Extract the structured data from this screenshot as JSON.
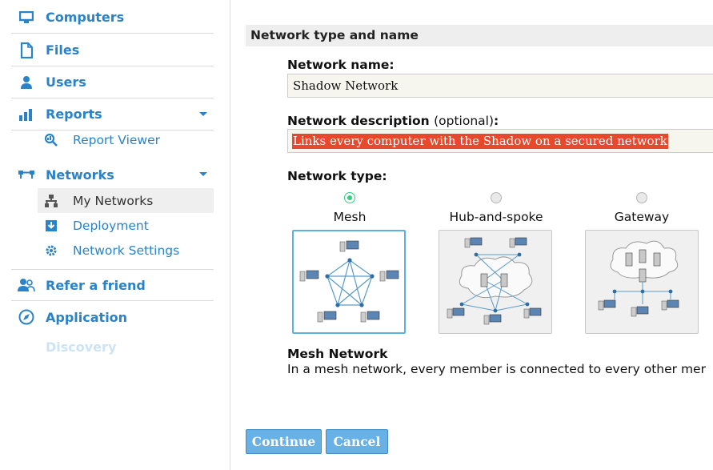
{
  "sidebar": {
    "items": [
      {
        "label": "Computers",
        "icon": "monitor-icon"
      },
      {
        "label": "Files",
        "icon": "file-icon"
      },
      {
        "label": "Users",
        "icon": "user-icon"
      },
      {
        "label": "Reports",
        "icon": "bar-chart-icon",
        "expanded": true
      },
      {
        "label": "Report Viewer",
        "icon": "report-viewer-icon"
      },
      {
        "label": "Networks",
        "icon": "network-icon",
        "expanded": true
      },
      {
        "label": "My Networks",
        "icon": "hierarchy-icon",
        "active": true
      },
      {
        "label": "Deployment",
        "icon": "download-icon"
      },
      {
        "label": "Network Settings",
        "icon": "gear-icon"
      },
      {
        "label": "Refer a friend",
        "icon": "refer-users-icon"
      },
      {
        "label": "Application",
        "icon": "compass-icon"
      },
      {
        "label": "Discovery",
        "icon": ""
      }
    ]
  },
  "main": {
    "section_title": "Network type and name",
    "name_label": "Network name:",
    "name_value": "Shadow Network",
    "description_label": "Network description",
    "description_optional": "(optional)",
    "description_colon": ":",
    "description_value": "Links every computer with the Shadow on a secured network",
    "type_label": "Network type:",
    "types": [
      {
        "label": "Mesh",
        "selected": true
      },
      {
        "label": "Hub-and-spoke",
        "selected": false
      },
      {
        "label": "Gateway",
        "selected": false
      }
    ],
    "selected_title": "Mesh Network",
    "selected_description": "In a mesh network, every member is connected to every other mer"
  },
  "buttons": {
    "continue": "Continue",
    "cancel": "Cancel"
  },
  "colors": {
    "accent": "#2a82c8",
    "button": "#68b1e6",
    "selection": "#e8482c",
    "radio_selected": "#2fcf7f"
  }
}
